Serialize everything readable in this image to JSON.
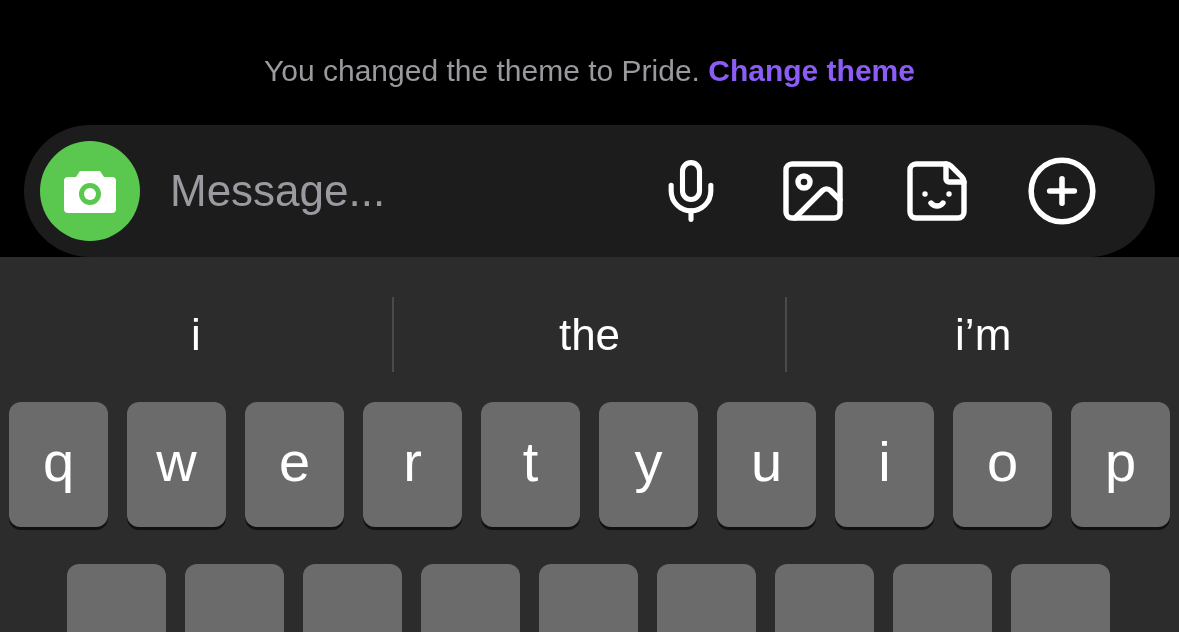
{
  "notice": {
    "text": "You changed the theme to Pride.",
    "link": "Change theme"
  },
  "composer": {
    "placeholder": "Message..."
  },
  "suggestions": [
    "i",
    "the",
    "i’m"
  ],
  "keyboard": {
    "rows": [
      [
        "q",
        "w",
        "e",
        "r",
        "t",
        "y",
        "u",
        "i",
        "o",
        "p"
      ]
    ]
  }
}
